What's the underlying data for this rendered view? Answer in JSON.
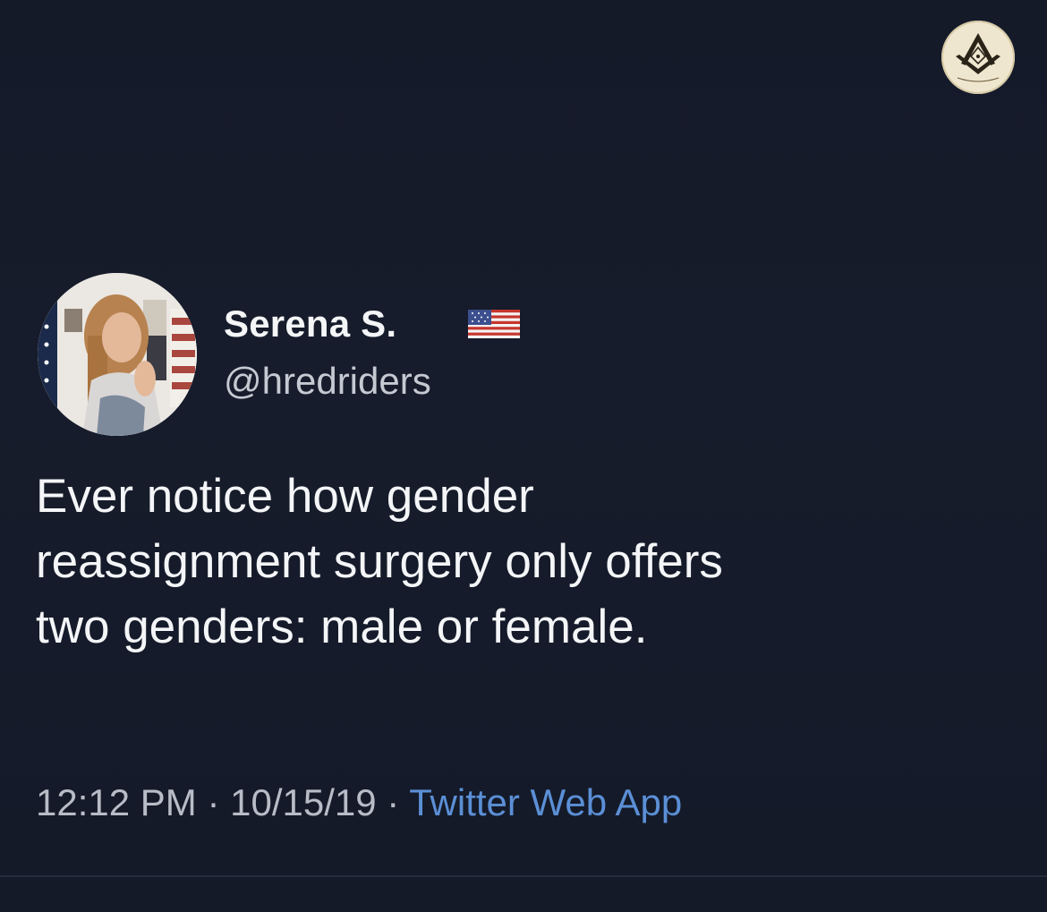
{
  "tweet": {
    "display_name": "Serena S.",
    "flag": "us-flag-icon",
    "handle": "@hredriders",
    "text_lines": [
      "Ever notice how gender",
      "reassignment surgery only offers",
      "two genders: male or female."
    ],
    "time": "12:12 PM",
    "separator": " · ",
    "date": "10/15/19",
    "source": "Twitter Web App"
  },
  "colors": {
    "background": "#151a29",
    "text": "#f4f5f7",
    "secondary_text": "#b7bcc6",
    "link": "#5b8fd6"
  }
}
